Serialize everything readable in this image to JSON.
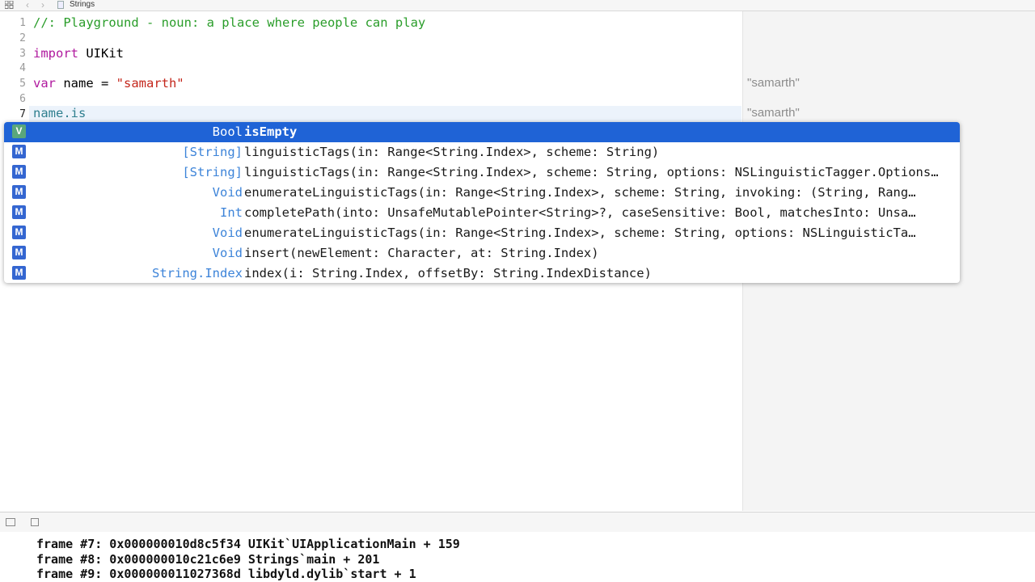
{
  "jumpbar": {
    "file_name": "Strings"
  },
  "editor": {
    "line_numbers": [
      "1",
      "2",
      "3",
      "4",
      "5",
      "6",
      "7"
    ],
    "line1_comment": "//: Playground - noun: a place where people can play",
    "line3_kw": "import",
    "line3_rest": " UIKit",
    "line5_kw": "var",
    "line5_mid": " name = ",
    "line5_str": "\"samarth\"",
    "line7_ident": "name",
    "line7_rest": ".is"
  },
  "results": {
    "line5": "\"samarth\"",
    "line7": "\"samarth\""
  },
  "completions": [
    {
      "kind": "V",
      "type": "Bool",
      "signature": "isEmpty"
    },
    {
      "kind": "M",
      "type": "[String]",
      "signature": "linguisticTags(in: Range<String.Index>, scheme: String)"
    },
    {
      "kind": "M",
      "type": "[String]",
      "signature": "linguisticTags(in: Range<String.Index>, scheme: String, options: NSLinguisticTagger.Options…"
    },
    {
      "kind": "M",
      "type": "Void",
      "signature": "enumerateLinguisticTags(in: Range<String.Index>, scheme: String, invoking: (String, Rang…"
    },
    {
      "kind": "M",
      "type": "Int",
      "signature": "completePath(into: UnsafeMutablePointer<String>?, caseSensitive: Bool, matchesInto: Unsa…"
    },
    {
      "kind": "M",
      "type": "Void",
      "signature": "enumerateLinguisticTags(in: Range<String.Index>, scheme: String, options: NSLinguisticTa…"
    },
    {
      "kind": "M",
      "type": "Void",
      "signature": "insert(newElement: Character, at: String.Index)"
    },
    {
      "kind": "M",
      "type": "String.Index",
      "signature": "index(i: String.Index, offsetBy: String.IndexDistance)"
    }
  ],
  "console": {
    "lines": [
      "frame #7: 0x000000010d8c5f34 UIKit`UIApplicationMain + 159",
      "frame #8: 0x000000010c21c6e9 Strings`main + 201",
      "frame #9: 0x000000011027368d libdyld.dylib`start + 1"
    ]
  },
  "colors": {
    "selection": "#1f63d6",
    "method_badge": "#3466d1",
    "var_badge": "#5aa77b",
    "type_text": "#3d84d9",
    "comment": "#2a9d2a",
    "keyword": "#b0199e",
    "string": "#c4271c"
  }
}
